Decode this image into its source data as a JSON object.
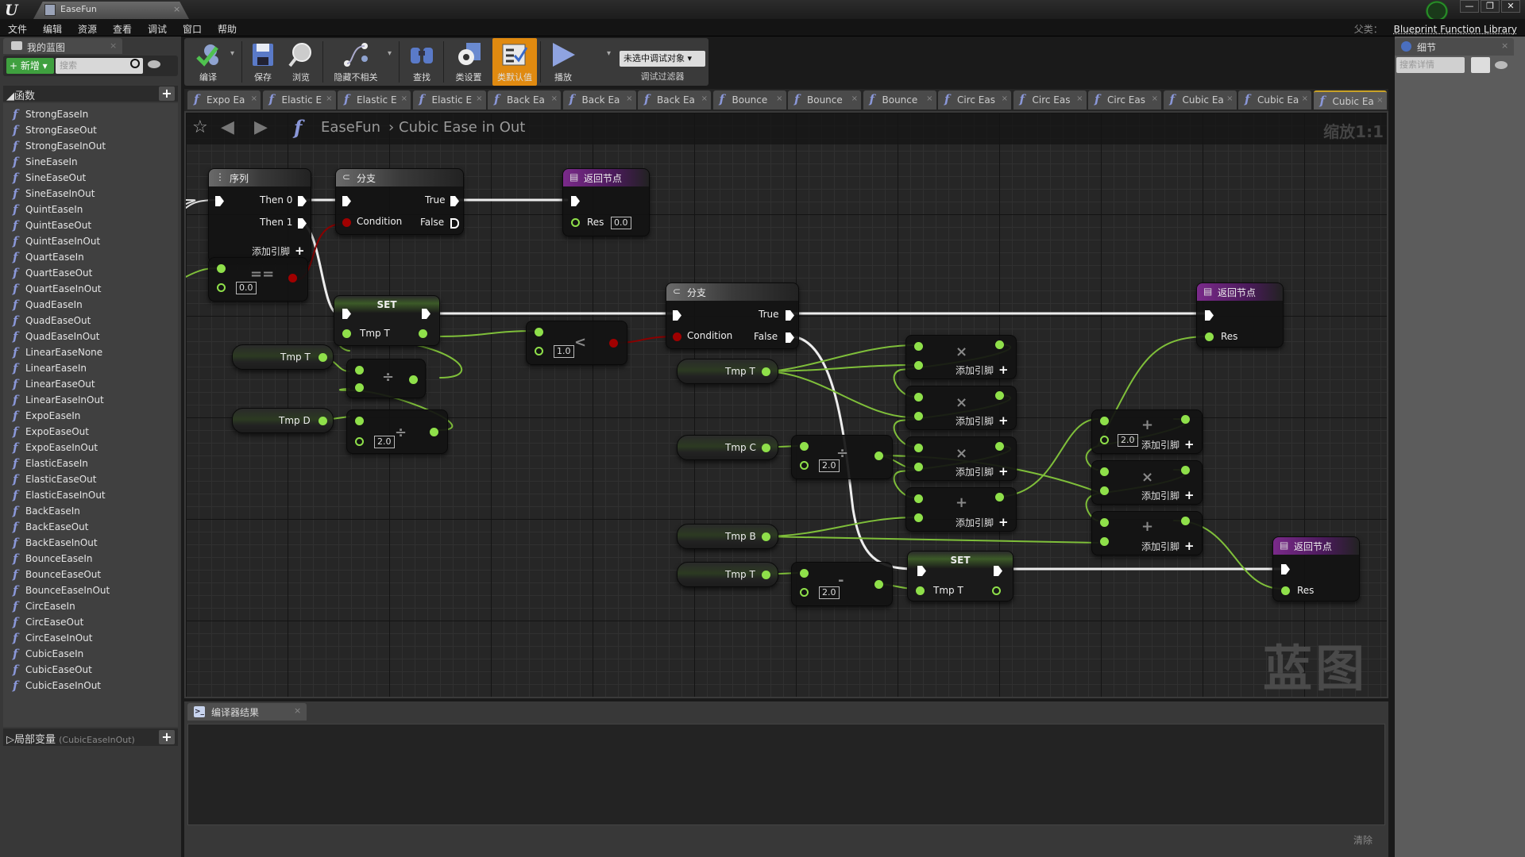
{
  "window": {
    "app_logo": "U",
    "doc_tab": "EaseFun",
    "controls": [
      "—",
      "❐",
      "✕"
    ]
  },
  "menu": {
    "items": [
      "文件",
      "编辑",
      "资源",
      "查看",
      "调试",
      "窗口",
      "帮助"
    ],
    "parent_class_label": "父类：",
    "parent_class": "Blueprint Function Library"
  },
  "my_blueprint": {
    "tab": "我的蓝图",
    "add_button": "+ 新增 ▾",
    "search_placeholder": "搜索",
    "functions_header": "◢函数",
    "functions": [
      "StrongEaseIn",
      "StrongEaseOut",
      "StrongEaseInOut",
      "SineEaseIn",
      "SineEaseOut",
      "SineEaseInOut",
      "QuintEaseIn",
      "QuintEaseOut",
      "QuintEaseInOut",
      "QuartEaseIn",
      "QuartEaseOut",
      "QuartEaseInOut",
      "QuadEaseIn",
      "QuadEaseOut",
      "QuadEaseInOut",
      "LinearEaseNone",
      "LinearEaseIn",
      "LinearEaseOut",
      "LinearEaseInOut",
      "ExpoEaseIn",
      "ExpoEaseOut",
      "ExpoEaseInOut",
      "ElasticEaseIn",
      "ElasticEaseOut",
      "ElasticEaseInOut",
      "BackEaseIn",
      "BackEaseOut",
      "BackEaseInOut",
      "BounceEaseIn",
      "BounceEaseOut",
      "BounceEaseInOut",
      "CircEaseIn",
      "CircEaseOut",
      "CircEaseInOut",
      "CubicEaseIn",
      "CubicEaseOut",
      "CubicEaseInOut"
    ],
    "locals_header": "▷局部变量",
    "locals_context": "(CubicEaseInOut)"
  },
  "toolbar": {
    "buttons": [
      {
        "label": "编译",
        "icon": "compile-icon"
      },
      {
        "label": "保存",
        "icon": "save-icon"
      },
      {
        "label": "浏览",
        "icon": "browse-icon"
      },
      {
        "label": "隐藏不相关",
        "icon": "hide-unrelated-icon"
      },
      {
        "label": "查找",
        "icon": "find-icon"
      },
      {
        "label": "类设置",
        "icon": "class-settings-icon"
      },
      {
        "label": "类默认值",
        "icon": "class-defaults-icon",
        "active": true
      },
      {
        "label": "播放",
        "icon": "play-icon"
      }
    ],
    "debug_select": "未选中调试对象 ▾",
    "debug_filter_label": "调试过滤器",
    "active_color": "#e08a10"
  },
  "graph_tabs": [
    "Expo Ea",
    "Elastic E",
    "Elastic E",
    "Elastic E",
    "Back Ea",
    "Back Ea",
    "Back Ea",
    "Bounce",
    "Bounce",
    "Bounce",
    "Circ Eas",
    "Circ Eas",
    "Circ Eas",
    "Cubic Ea",
    "Cubic Ea",
    "Cubic Ea"
  ],
  "graph": {
    "breadcrumb_root": "EaseFun",
    "breadcrumb_sep": "›",
    "breadcrumb_current": "Cubic Ease in Out",
    "zoom_label": "缩放1:1",
    "watermark": "蓝图",
    "nodes": {
      "sequence": {
        "title": "序列",
        "then0": "Then 0",
        "then1": "Then 1",
        "add_pin": "添加引脚"
      },
      "branch1": {
        "title": "分支",
        "true": "True",
        "false": "False",
        "condition": "Condition"
      },
      "return1": {
        "title": "返回节点",
        "res": "Res",
        "res_value": "0.0"
      },
      "equals": {
        "op": "==",
        "value": "0.0"
      },
      "set1": {
        "title": "SET",
        "var": "Tmp T"
      },
      "get_t1": {
        "label": "Tmp T"
      },
      "get_d": {
        "label": "Tmp D"
      },
      "divide1": {
        "op": "÷"
      },
      "divide2": {
        "op": "÷",
        "value": "2.0"
      },
      "less": {
        "op": "<",
        "value": "1.0"
      },
      "branch2": {
        "title": "分支",
        "true": "True",
        "false": "False",
        "condition": "Condition"
      },
      "return2": {
        "title": "返回节点",
        "res": "Res"
      },
      "get_t2": {
        "label": "Tmp T"
      },
      "get_c": {
        "label": "Tmp C"
      },
      "get_b": {
        "label": "Tmp B"
      },
      "get_t3": {
        "label": "Tmp T"
      },
      "divide3": {
        "op": "÷",
        "value": "2.0"
      },
      "subtract": {
        "op": "-",
        "value": "2.0"
      },
      "mul1": {
        "op": "×",
        "add_pin": "添加引脚"
      },
      "mul2": {
        "op": "×",
        "add_pin": "添加引脚"
      },
      "mul3": {
        "op": "×",
        "add_pin": "添加引脚"
      },
      "add1": {
        "op": "+",
        "add_pin": "添加引脚"
      },
      "add2": {
        "op": "+",
        "value": "2.0",
        "add_pin": "添加引脚"
      },
      "mul4": {
        "op": "×",
        "add_pin": "添加引脚"
      },
      "add3": {
        "op": "+",
        "add_pin": "添加引脚"
      },
      "set2": {
        "title": "SET",
        "var": "Tmp T"
      },
      "return3": {
        "title": "返回节点",
        "res": "Res"
      }
    }
  },
  "compiler": {
    "tab": "编译器结果",
    "clear": "清除"
  },
  "details": {
    "tab": "细节",
    "search_placeholder": "搜索详情"
  }
}
